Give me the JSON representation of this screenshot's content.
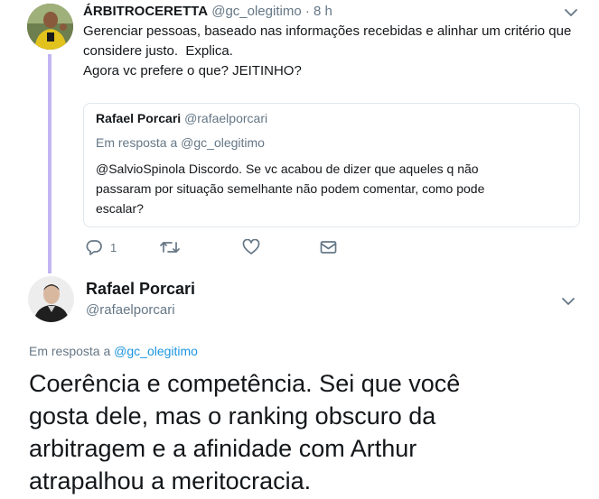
{
  "parent_tweet": {
    "display_name": "ÁRBITROCERETTA",
    "handle": "@gc_olegitimo",
    "separator": "·",
    "time": "8 h",
    "text_lines": [
      "Gerenciar pessoas, baseado nas informações recebidas e alinhar um critério que",
      "considere justo.  Explica.",
      "Agora vc prefere o que? JEITINHO?"
    ],
    "quoted": {
      "display_name": "Rafael Porcari",
      "handle": "@rafaelporcari",
      "reply_prefix": "Em resposta a",
      "reply_to": "@gc_olegitimo",
      "text_lines": [
        "@SalvioSpinola Discordo. Se vc acabou de dizer que aqueles q não",
        "passaram por situação semelhante não podem comentar, como pode",
        "escalar?"
      ]
    },
    "actions": {
      "reply_count": "1",
      "reply_icon": "reply-icon",
      "retweet_icon": "retweet-icon",
      "like_icon": "heart-icon",
      "dm_icon": "envelope-icon"
    }
  },
  "main_tweet": {
    "display_name": "Rafael Porcari",
    "handle": "@rafaelporcari",
    "reply_prefix": "Em resposta a",
    "reply_to": "@gc_olegitimo",
    "text_lines": [
      "Coerência e competência. Sei que você",
      "gosta dele, mas o ranking obscuro da",
      "arbitragem e a afinidade com Arthur",
      "atrapalhou a meritocracia."
    ]
  },
  "colors": {
    "link": "#1b95e0",
    "muted": "#657786",
    "thread_line": "#c3b5f2",
    "text": "#14171a"
  }
}
